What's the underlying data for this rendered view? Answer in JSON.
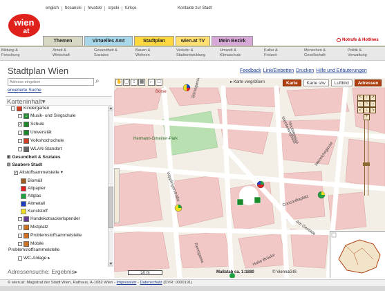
{
  "top_languages": [
    "english",
    "bosanski",
    "hrvatski",
    "srpski",
    "türkçe"
  ],
  "top_kontakte": "Kontakte zur Stadt",
  "logo": {
    "line1": "wien",
    "line2": "at"
  },
  "tabs": [
    {
      "label": "Themen",
      "color": "#d8d8c4"
    },
    {
      "label": "Virtuelles Amt",
      "color": "#a7d7e8"
    },
    {
      "label": "Stadtplan",
      "color": "#ffd840"
    },
    {
      "label": "wien.at TV",
      "color": "#ffe070"
    },
    {
      "label": "Mein Bezirk",
      "color": "#d7a8d8"
    }
  ],
  "notruf": "Notrufe & Hotlines",
  "categories": [
    {
      "l1": "Bildung &",
      "l2": "Forschung"
    },
    {
      "l1": "Arbeit &",
      "l2": "Wirtschaft"
    },
    {
      "l1": "Gesundheit &",
      "l2": "Soziales"
    },
    {
      "l1": "Bauen &",
      "l2": "Wohnen"
    },
    {
      "l1": "Verkehr &",
      "l2": "Stadtentwicklung"
    },
    {
      "l1": "Umwelt &",
      "l2": "Klimaschutz"
    },
    {
      "l1": "Kultur &",
      "l2": "Freizeit"
    },
    {
      "l1": "Menschen &",
      "l2": "Gesellschaft"
    },
    {
      "l1": "Politik &",
      "l2": "Verwaltung"
    }
  ],
  "page_title": "Stadtplan Wien",
  "top_links": [
    "Feedback",
    "Link/Einbetten",
    "Drucken",
    "Hilfe und Erläuterungen"
  ],
  "search": {
    "placeholder": "Adresse eingeben",
    "advanced": "erweiterte Suche"
  },
  "panel_title": "Karteninhalt",
  "content_rows": [
    {
      "label": "Kindergarten",
      "checked": false,
      "icon_color": "#d04020",
      "indent": 2
    },
    {
      "label": "Musik- und Singschule",
      "checked": false,
      "icon_color": "#1a8a2a",
      "indent": 2
    },
    {
      "label": "Schule",
      "checked": true,
      "icon_color": "#1a8a2a",
      "indent": 2
    },
    {
      "label": "Universität",
      "checked": false,
      "icon_color": "#1a8a2a",
      "indent": 2
    },
    {
      "label": "Volkshochschule",
      "checked": false,
      "icon_color": "#d04020",
      "indent": 2
    },
    {
      "label": "WLAN-Standort",
      "checked": false,
      "icon_color": "#666666",
      "indent": 2
    }
  ],
  "group_gesundheit": "Gesundheit & Soziales",
  "group_saubere": "Saubere Stadt",
  "altstoff": "Altstoffsammelstelle",
  "swatches": [
    {
      "label": "Biomüll",
      "color": "#a05a20"
    },
    {
      "label": "Altpapier",
      "color": "#e02020"
    },
    {
      "label": "Altglas",
      "color": "#20a040"
    },
    {
      "label": "Altmetall",
      "color": "#2040c0"
    },
    {
      "label": "Kunststoff",
      "color": "#f0e020"
    }
  ],
  "more_rows": [
    {
      "label": "Hundekotsackerlspender",
      "icon_color": "#6a3a9a"
    },
    {
      "label": "Mistplatz",
      "icon_color": "#d07020"
    },
    {
      "label": "Problemstoffsammelstelle",
      "icon_color": "#d07020"
    },
    {
      "label": "Mobile",
      "icon_color": "#d07020"
    }
  ],
  "mobile_line2": "Problemstoffsammelstelle",
  "wc_row": "WC-Anlage",
  "adressen_result": "Adressensuche: Ergebnis",
  "map": {
    "karte_vergroessern": "Karte vergrößern",
    "buttons": [
      "Karte",
      "Karte s/w",
      "Luftbild",
      "Adressen"
    ],
    "scale_label": "50 m",
    "massstab": "Maßstab ca. 1:1880",
    "copyright": "© ViennaGIS",
    "street_labels": [
      {
        "text": "Börse"
      },
      {
        "text": "Hermann-Gmeiner-Park"
      },
      {
        "text": "Börsegasse"
      },
      {
        "text": "Wipplingerstraße"
      },
      {
        "text": "Werdertorgasse"
      },
      {
        "text": "Concordiaplatz"
      },
      {
        "text": "Renngasse"
      },
      {
        "text": "Am Gestade"
      },
      {
        "text": "Hohe Brücke"
      },
      {
        "text": "Heinrichsgasse"
      },
      {
        "text": "Neutorgasse"
      }
    ],
    "accent": "#b04010"
  },
  "footer": {
    "prefix": "© wien.at: Magistrat der Stadt Wien, Rathaus, A-1082 Wien - ",
    "impressum": "Impressum",
    "sep": " - ",
    "datenschutz": "Datenschutz",
    "dvr": " (DVR: 0000191)"
  }
}
